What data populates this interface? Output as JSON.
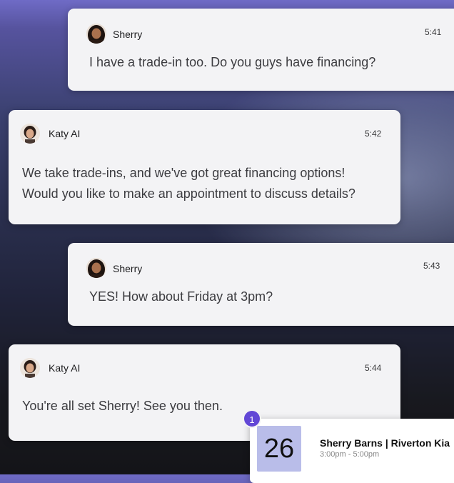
{
  "messages": [
    {
      "sender": "Sherry",
      "avatar_icon": "sherry-avatar-icon",
      "time": "5:41",
      "text": "I have a trade-in too. Do you guys have financing?"
    },
    {
      "sender": "Katy AI",
      "avatar_icon": "katy-ai-avatar-icon",
      "time": "5:42",
      "text_lines": [
        "We take trade-ins, and we've got great financing options!",
        "Would you like to make an appointment to discuss details?"
      ]
    },
    {
      "sender": "Sherry",
      "avatar_icon": "sherry-avatar-icon",
      "time": "5:43",
      "text": "YES! How about Friday at 3pm?"
    },
    {
      "sender": "Katy AI",
      "avatar_icon": "katy-ai-avatar-icon",
      "time": "5:44",
      "text": "You're all set Sherry! See you then."
    }
  ],
  "appointment": {
    "badge_count": "1",
    "day": "26",
    "title": "Sherry Barns | Riverton Kia",
    "time_range": "3:00pm - 5:00pm"
  },
  "colors": {
    "badge": "#6247d6",
    "date_box": "#b9bde9",
    "card": "#f3f3f5"
  }
}
